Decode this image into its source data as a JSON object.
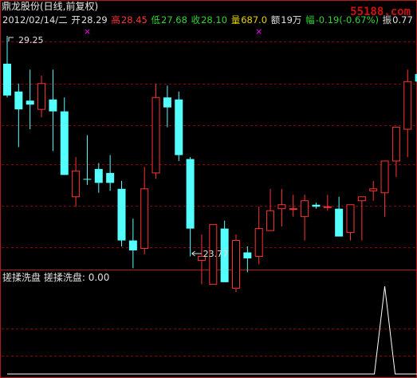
{
  "header": {
    "title": "鼎龙股份(日线,前复权)",
    "date": "2012/02/14/二",
    "open_label": "开",
    "open_value": "28.29",
    "high_label": "高",
    "high_value": "28.45",
    "low_label": "低",
    "low_value": "27.68",
    "close_label": "收",
    "close_value": "28.10",
    "volume_label": "量",
    "volume_value": "687.0",
    "amount_label": "额",
    "amount_value": "19万",
    "change_label": "幅",
    "change_value": "-0.19(-0.67%)",
    "amplitude_label": "振",
    "amplitude_value": "0.77",
    "watermark": "55188.com"
  },
  "indicator": {
    "name": "搓揉洗盘",
    "value_label": "搓揉洗盘: 0.00"
  },
  "colors": {
    "up": "#ff3232",
    "down": "#54ffff",
    "signal_line": "#ffffff",
    "grid": "#8b0000",
    "border": "#b01a1a",
    "marker": "#ff00ff"
  },
  "chart_data": [
    {
      "type": "candlestick",
      "title": "鼎龙股份(日线,前复权)",
      "annotations": [
        {
          "text": "29.25",
          "label": "high_marker"
        },
        {
          "text": "23.77",
          "label": "low_marker"
        }
      ],
      "ohlc": [
        {
          "o": 28.55,
          "h": 29.25,
          "l": 27.7,
          "c": 27.75
        },
        {
          "o": 27.85,
          "h": 28.05,
          "l": 26.45,
          "c": 27.4
        },
        {
          "o": 27.62,
          "h": 28.4,
          "l": 26.9,
          "c": 27.52
        },
        {
          "o": 27.4,
          "h": 28.25,
          "l": 27.2,
          "c": 28.05
        },
        {
          "o": 27.65,
          "h": 28.4,
          "l": 26.35,
          "c": 27.35
        },
        {
          "o": 27.35,
          "h": 27.7,
          "l": 25.85,
          "c": 25.75
        },
        {
          "o": 25.2,
          "h": 26.2,
          "l": 24.95,
          "c": 25.85
        },
        {
          "o": 25.65,
          "h": 26.75,
          "l": 25.5,
          "c": 25.63
        },
        {
          "o": 25.9,
          "h": 26.05,
          "l": 25.3,
          "c": 25.55
        },
        {
          "o": 25.8,
          "h": 26.25,
          "l": 25.35,
          "c": 25.55
        },
        {
          "o": 25.4,
          "h": 25.6,
          "l": 23.95,
          "c": 24.1
        },
        {
          "o": 24.1,
          "h": 24.65,
          "l": 23.4,
          "c": 23.85
        },
        {
          "o": 23.9,
          "h": 25.95,
          "l": 23.75,
          "c": 25.4
        },
        {
          "o": 25.8,
          "h": 28.05,
          "l": 25.65,
          "c": 27.7
        },
        {
          "o": 27.7,
          "h": 28.0,
          "l": 26.95,
          "c": 27.45
        },
        {
          "o": 27.65,
          "h": 27.85,
          "l": 26.1,
          "c": 26.25
        },
        {
          "o": 26.15,
          "h": 26.2,
          "l": 23.7,
          "c": 24.4
        },
        {
          "o": 23.6,
          "h": 24.25,
          "l": 23.0,
          "c": 23.7
        },
        {
          "o": 23.0,
          "h": 24.05,
          "l": 23.05,
          "c": 24.5
        },
        {
          "o": 24.4,
          "h": 24.6,
          "l": 23.15,
          "c": 23.05
        },
        {
          "o": 22.9,
          "h": 24.25,
          "l": 22.8,
          "c": 24.1
        },
        {
          "o": 23.8,
          "h": 23.95,
          "l": 23.3,
          "c": 23.65
        },
        {
          "o": 23.7,
          "h": 24.95,
          "l": 23.5,
          "c": 24.4
        },
        {
          "o": 24.35,
          "h": 25.4,
          "l": 24.7,
          "c": 24.85
        },
        {
          "o": 24.9,
          "h": 25.4,
          "l": 24.45,
          "c": 25.0
        },
        {
          "o": 24.9,
          "h": 25.25,
          "l": 24.7,
          "c": 24.9
        },
        {
          "o": 24.7,
          "h": 25.25,
          "l": 24.1,
          "c": 25.1
        },
        {
          "o": 25.0,
          "h": 25.05,
          "l": 24.9,
          "c": 24.95
        },
        {
          "o": 24.95,
          "h": 25.25,
          "l": 24.85,
          "c": 24.95
        },
        {
          "o": 24.9,
          "h": 25.2,
          "l": 24.45,
          "c": 24.2
        },
        {
          "o": 24.3,
          "h": 24.35,
          "l": 24.1,
          "c": 25.0
        },
        {
          "o": 25.1,
          "h": 25.1,
          "l": 24.1,
          "c": 25.2
        },
        {
          "o": 25.35,
          "h": 25.6,
          "l": 25.1,
          "c": 25.4
        },
        {
          "o": 25.3,
          "h": 25.4,
          "l": 24.7,
          "c": 26.1
        },
        {
          "o": 26.1,
          "h": 26.9,
          "l": 25.7,
          "c": 26.95
        },
        {
          "o": 26.9,
          "h": 28.4,
          "l": 26.2,
          "c": 28.1
        },
        {
          "o": 28.29,
          "h": 28.45,
          "l": 27.68,
          "c": 28.1
        }
      ],
      "markers": [
        {
          "index": 7,
          "symbol": "×"
        },
        {
          "index": 22,
          "symbol": "×"
        }
      ]
    },
    {
      "type": "line",
      "title": "搓揉洗盘",
      "series": [
        {
          "name": "搓揉洗盘",
          "values": [
            0,
            0,
            0,
            0,
            0,
            0,
            0,
            0,
            0,
            0,
            0,
            0,
            0,
            0,
            0,
            0,
            0,
            0,
            0,
            0,
            0,
            0,
            0,
            0,
            0,
            0,
            0,
            0,
            0,
            0,
            0,
            0,
            0,
            1,
            0,
            0,
            0
          ]
        }
      ]
    }
  ]
}
